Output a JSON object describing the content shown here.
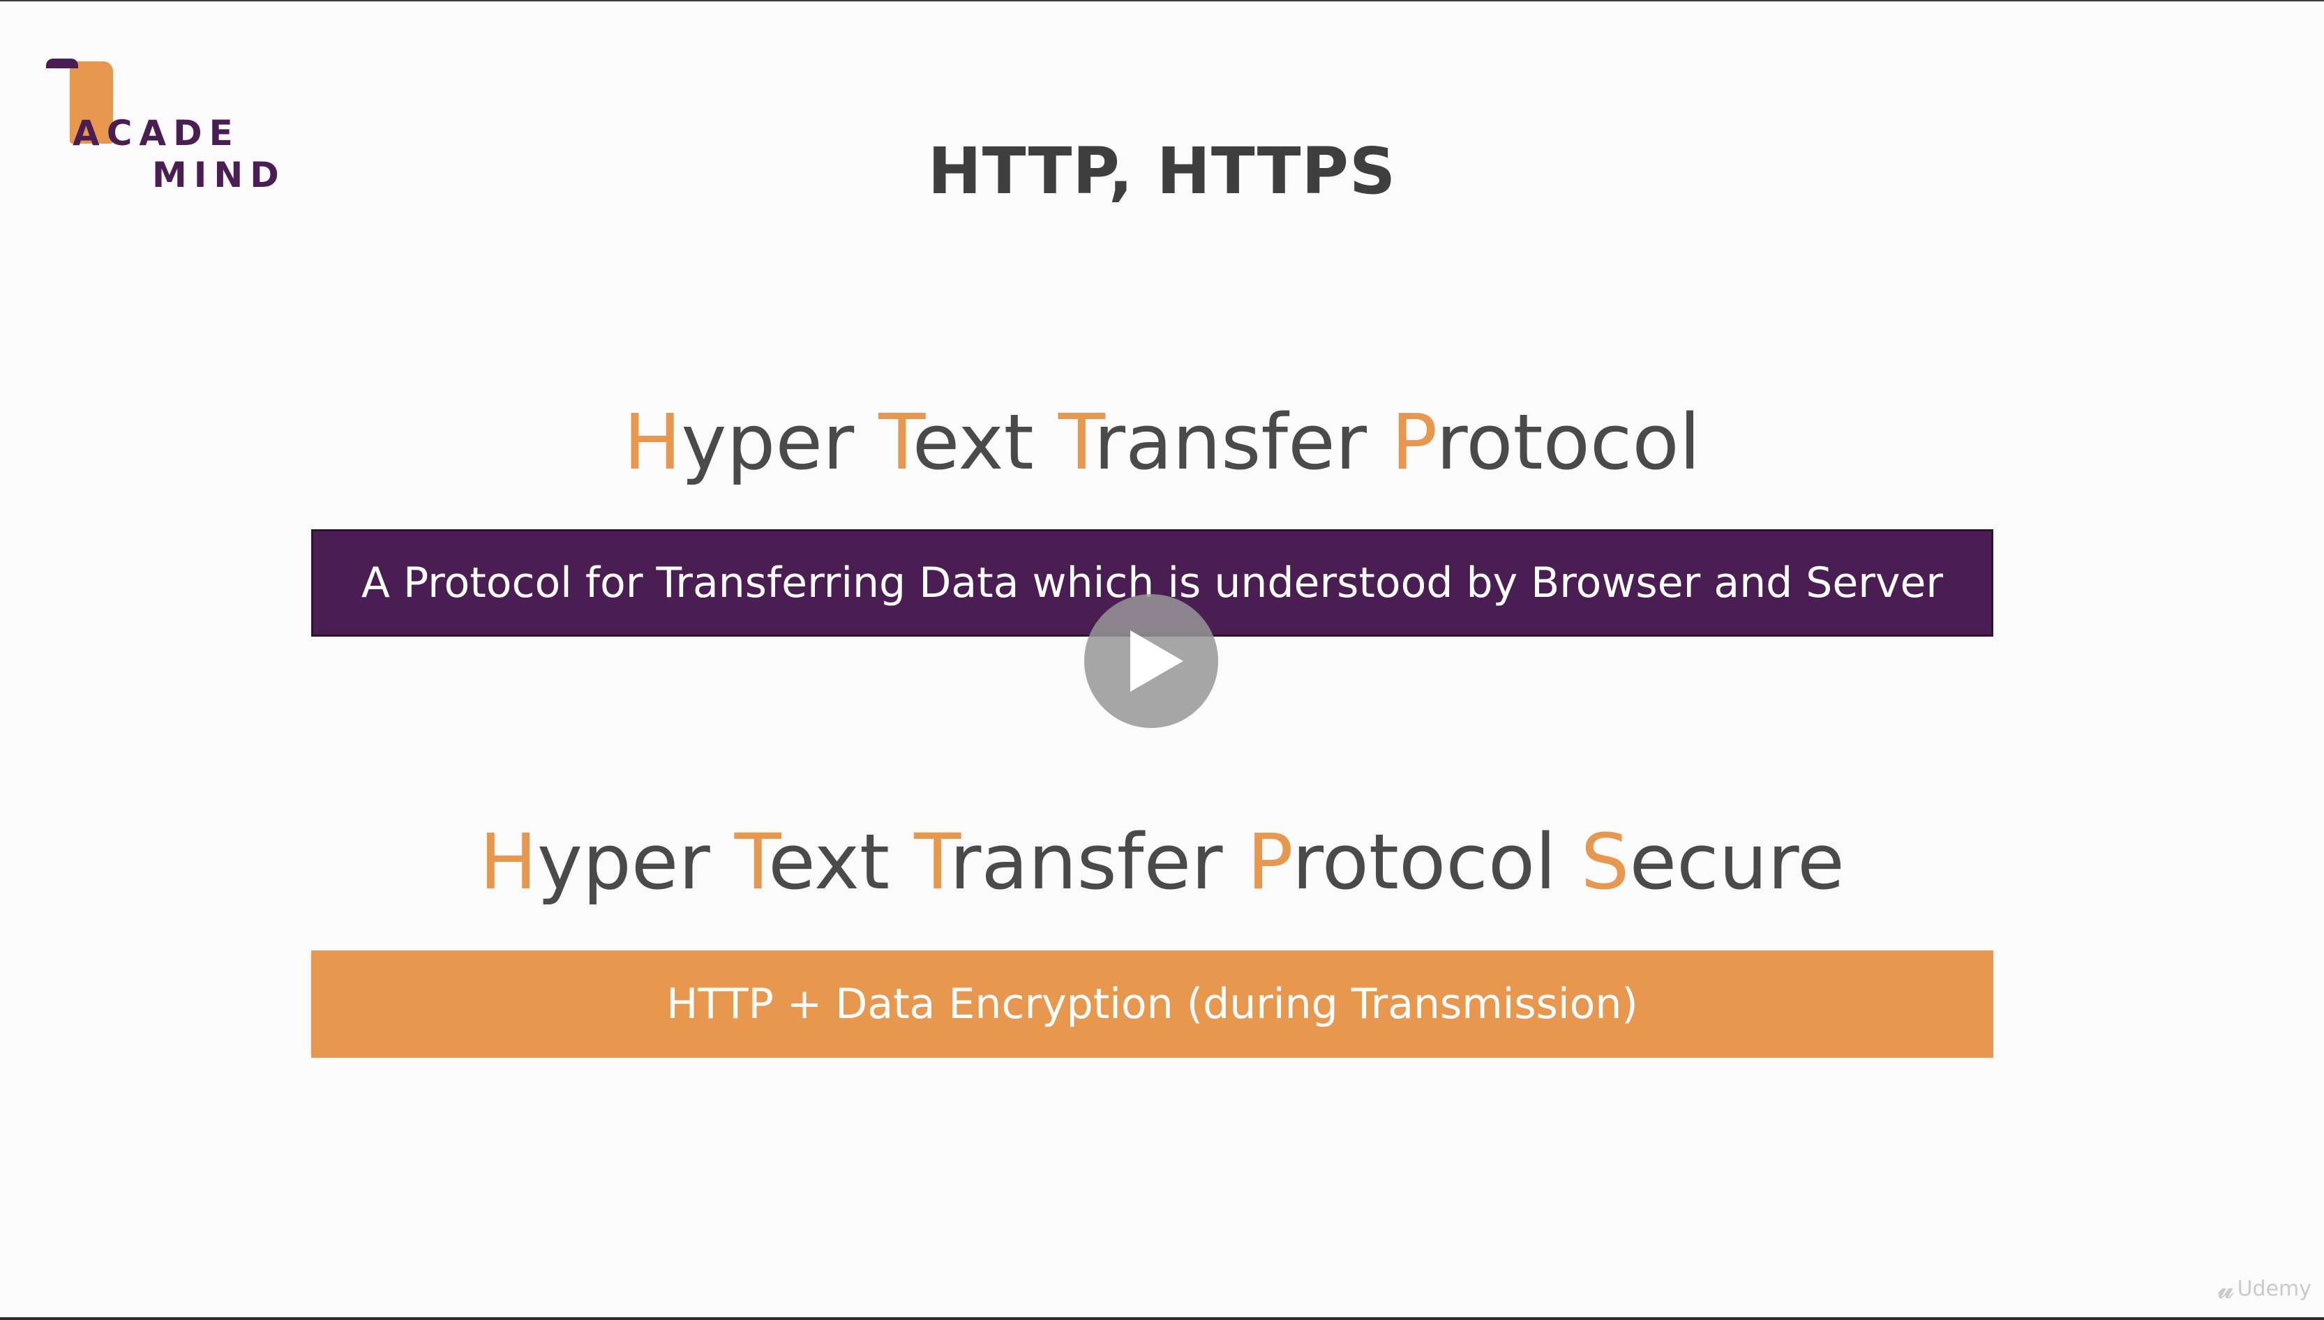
{
  "logo": {
    "line1": "ACADE",
    "line2": "MIND"
  },
  "slide": {
    "title": "HTTP, HTTPS",
    "http_heading": [
      {
        "initial": "H",
        "rest": "yper"
      },
      {
        "initial": "T",
        "rest": "ext"
      },
      {
        "initial": "T",
        "rest": "ransfer"
      },
      {
        "initial": "P",
        "rest": "rotocol"
      }
    ],
    "http_description": "A Protocol for Transferring Data which is understood by Browser and Server",
    "https_heading": [
      {
        "initial": "H",
        "rest": "yper"
      },
      {
        "initial": "T",
        "rest": "ext"
      },
      {
        "initial": "T",
        "rest": "ransfer"
      },
      {
        "initial": "P",
        "rest": "rotocol"
      },
      {
        "initial": "S",
        "rest": "ecure"
      }
    ],
    "https_description": "HTTP + Data Encryption (during Transmission)"
  },
  "colors": {
    "accent_orange": "#e8974f",
    "accent_purple": "#4a1e52",
    "text_dark": "#4a4a4a"
  },
  "icons": {
    "play": "play-icon",
    "watermark": "udemy-logo-icon"
  },
  "watermark": {
    "label": "Udemy"
  }
}
